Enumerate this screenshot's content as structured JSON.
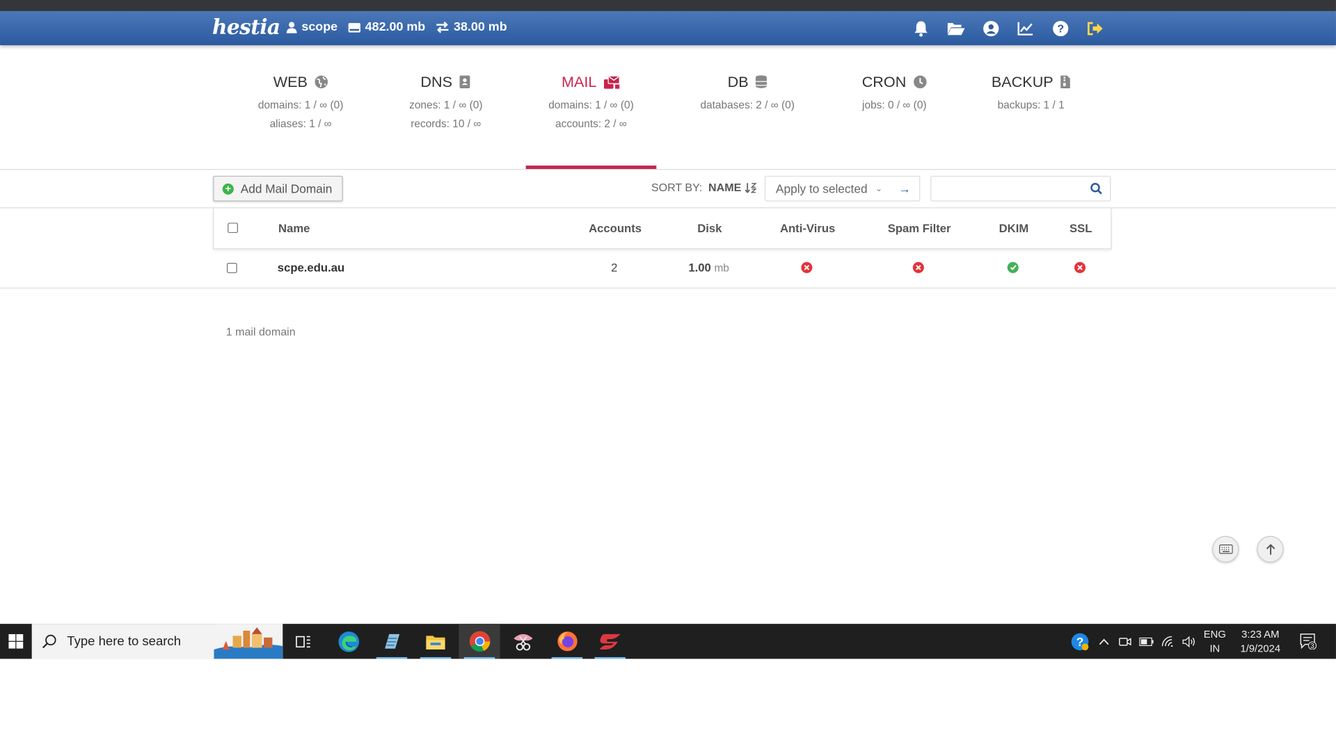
{
  "app": {
    "logo_text": "hestia",
    "user": "scope",
    "disk_usage": "482.00 mb",
    "bandwidth": "38.00 mb"
  },
  "tabs": [
    {
      "label": "WEB",
      "line1": "domains: 1 / ∞ (0)",
      "line2": "aliases: 1 / ∞",
      "icon": "globe-icon"
    },
    {
      "label": "DNS",
      "line1": "zones: 1 / ∞ (0)",
      "line2": "records: 10 / ∞",
      "icon": "address-book-icon"
    },
    {
      "label": "MAIL",
      "line1": "domains: 1 / ∞ (0)",
      "line2": "accounts: 2 / ∞",
      "icon": "mail-bulk-icon",
      "active": true
    },
    {
      "label": "DB",
      "line1": "databases: 2 / ∞ (0)",
      "line2": "",
      "icon": "database-icon"
    },
    {
      "label": "CRON",
      "line1": "jobs: 0 / ∞ (0)",
      "line2": "",
      "icon": "clock-icon"
    },
    {
      "label": "BACKUP",
      "line1": "backups: 1 / 1",
      "line2": "",
      "icon": "file-archive-icon"
    }
  ],
  "toolbar": {
    "add_label": "Add Mail Domain",
    "sort_by_label": "SORT BY:",
    "sort_value": "NAME",
    "apply_label": "Apply to selected",
    "search_placeholder": ""
  },
  "table": {
    "headers": {
      "name": "Name",
      "accounts": "Accounts",
      "disk": "Disk",
      "antivirus": "Anti-Virus",
      "spam": "Spam Filter",
      "dkim": "DKIM",
      "ssl": "SSL"
    },
    "rows": [
      {
        "name": "scpe.edu.au",
        "accounts": "2",
        "disk_value": "1.00",
        "disk_unit": "mb",
        "antivirus": false,
        "spam": false,
        "dkim": true,
        "ssl": false
      }
    ],
    "summary": "1 mail domain"
  },
  "taskbar": {
    "search_placeholder": "Type here to search",
    "lang_line1": "ENG",
    "lang_line2": "IN",
    "time": "3:23 AM",
    "date": "1/9/2024",
    "notification_count": "3"
  },
  "colors": {
    "topbar": "#2c5aa0",
    "accent": "#c7254e",
    "ok": "#44b05a",
    "error": "#e5323a"
  }
}
